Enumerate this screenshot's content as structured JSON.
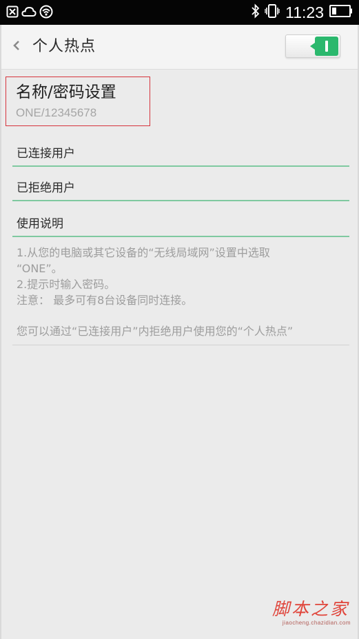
{
  "status_bar": {
    "time": "11:23",
    "left_icons": [
      "close-box-icon",
      "cloud-icon",
      "hotspot-signal-icon"
    ],
    "right_icons": [
      "bluetooth-icon",
      "vibrate-icon",
      "battery-icon"
    ]
  },
  "header": {
    "title": "个人热点",
    "toggle_on": true
  },
  "name_password": {
    "title": "名称/密码设置",
    "value": "ONE/12345678"
  },
  "rows": [
    {
      "label": "已连接用户"
    },
    {
      "label": "已拒绝用户"
    },
    {
      "label": "使用说明"
    }
  ],
  "instructions": {
    "line1": "1.从您的电脑或其它设备的“无线局域网”设置中选取",
    "line2": "“ONE”。",
    "line3": "2.提示时输入密码。",
    "line4": "注意：  最多可有8台设备同时连接。",
    "note": "您可以通过“已连接用户”内拒绝用户使用您的“个人热点”"
  },
  "watermark": {
    "title": "脚本之家",
    "subtitle": "jiaocheng.chazidian.com"
  },
  "colors": {
    "accent_green": "#2bb86d",
    "divider_green": "#7fc9a0",
    "highlight_red": "#d6333b"
  }
}
